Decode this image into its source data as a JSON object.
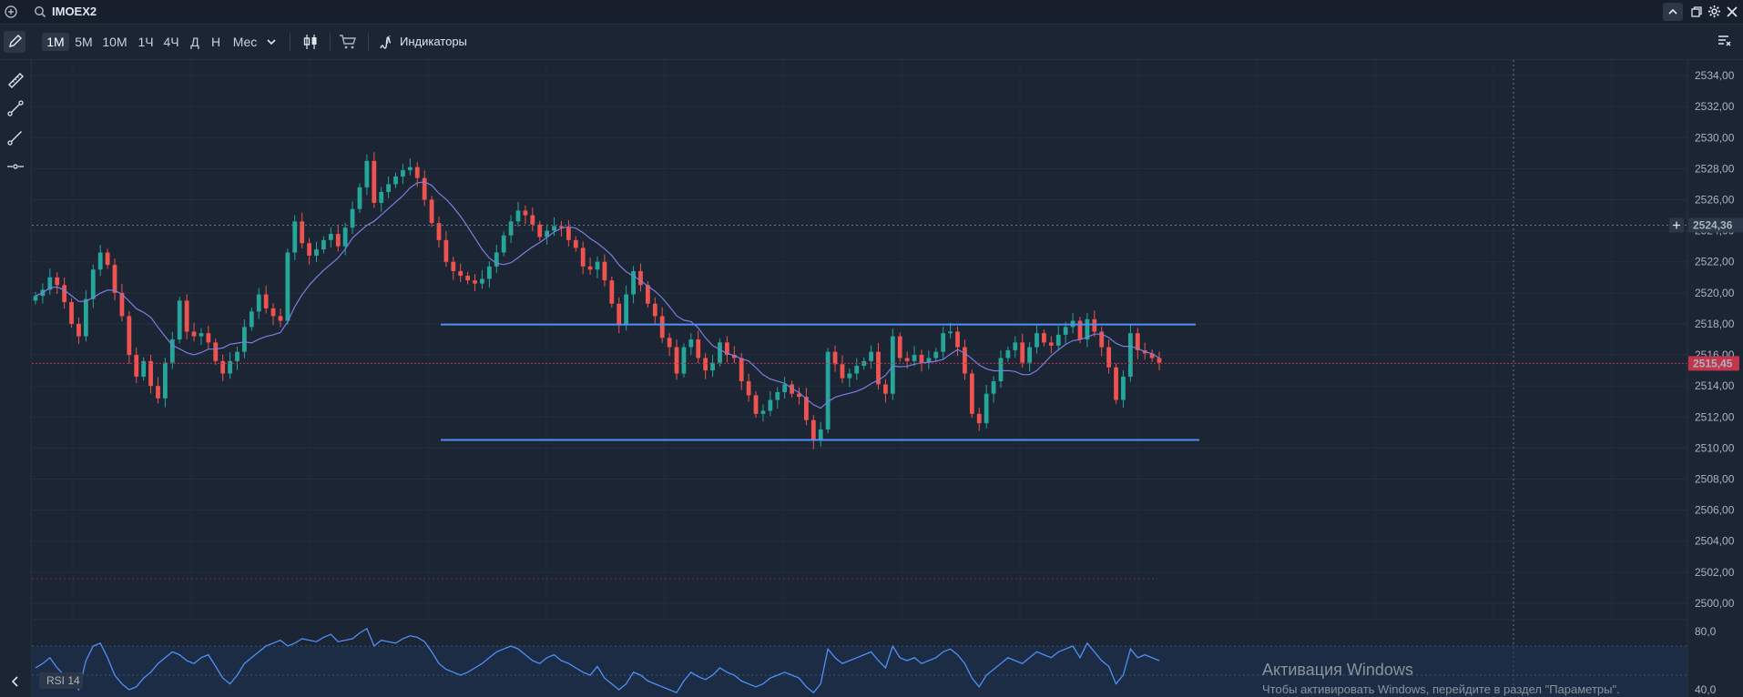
{
  "header": {
    "symbol": "IMOEX2"
  },
  "toolbar": {
    "timeframes": [
      "1М",
      "5М",
      "10М",
      "1Ч",
      "4Ч",
      "Д",
      "Н",
      "Мес"
    ],
    "active_timeframe": "1М",
    "indicators_label": "Индикаторы"
  },
  "price_axis": {
    "ticks": [
      "2534,00",
      "2532,00",
      "2530,00",
      "2528,00",
      "2526,00",
      "2524,00",
      "2522,00",
      "2520,00",
      "2518,00",
      "2516,00",
      "2514,00",
      "2512,00",
      "2510,00",
      "2508,00",
      "2506,00",
      "2504,00",
      "2502,00",
      "2500,00"
    ],
    "crosshair_label": "2524,36",
    "last_price_label": "2515,45"
  },
  "rsi": {
    "name": "RSI 14",
    "ticks": [
      "80,0",
      "40,0"
    ]
  },
  "colors": {
    "background": "#1b2533",
    "up_candle": "#26a69a",
    "down_candle": "#ef5350",
    "ma_line": "#7b7fe0",
    "channel_lines": "#4f8ff7",
    "last_price": "#c2364b",
    "rsi_line": "#4f8ff7"
  },
  "chart_data": {
    "type": "candlestick",
    "symbol": "IMOEX2",
    "interval": "1М",
    "ylim": [
      2499,
      2535
    ],
    "close_series": [
      2519.8,
      2520.2,
      2521,
      2520.5,
      2519.4,
      2518,
      2517.2,
      2519.6,
      2521.5,
      2522.6,
      2521.8,
      2520,
      2518.5,
      2516,
      2514.6,
      2515.6,
      2514,
      2513.2,
      2515.5,
      2517,
      2519.5,
      2517.5,
      2517.2,
      2517.4,
      2516.8,
      2515.6,
      2514.8,
      2515.6,
      2516.2,
      2517.8,
      2518.8,
      2519.9,
      2519,
      2518.5,
      2518.2,
      2522.6,
      2524.6,
      2523.2,
      2522.4,
      2522.8,
      2523.4,
      2523.8,
      2523,
      2524.2,
      2525.4,
      2526.8,
      2528.5,
      2525.8,
      2526.5,
      2527,
      2527.5,
      2527.9,
      2528.1,
      2527.4,
      2526,
      2524.5,
      2523.4,
      2522,
      2521.4,
      2521.1,
      2520.8,
      2520.6,
      2520.9,
      2521.7,
      2522.6,
      2523.7,
      2524.6,
      2525.3,
      2525,
      2524.4,
      2523.6,
      2524,
      2524.3,
      2524.2,
      2523.4,
      2522.9,
      2521.7,
      2521.5,
      2522,
      2520.8,
      2519.3,
      2517.9,
      2519.9,
      2521.4,
      2520.5,
      2519.3,
      2518.5,
      2517.1,
      2516.5,
      2514.8,
      2516.5,
      2517,
      2515.8,
      2515,
      2515.5,
      2516.8,
      2516,
      2515.8,
      2514.3,
      2513.4,
      2512.2,
      2512.4,
      2513.1,
      2513.6,
      2514.1,
      2513.5,
      2513.3,
      2511.8,
      2510.5,
      2511.2,
      2516.2,
      2515.4,
      2514.5,
      2514.8,
      2515.3,
      2515.6,
      2516.2,
      2514.1,
      2513.5,
      2517.2,
      2515.8,
      2515.6,
      2516,
      2515.5,
      2515.8,
      2516.2,
      2517.4,
      2517.5,
      2516.5,
      2514.8,
      2512.2,
      2511.6,
      2513.5,
      2514.3,
      2515.8,
      2516.3,
      2516.8,
      2515.5,
      2516.5,
      2517.4,
      2516.8,
      2516.6,
      2517.3,
      2517.8,
      2518.2,
      2517,
      2518.3,
      2517.5,
      2516.5,
      2515.2,
      2513.1,
      2514.6,
      2517.4,
      2516.3,
      2516.1,
      2515.8,
      2515.5
    ],
    "series": [
      {
        "name": "MA",
        "type": "line"
      }
    ],
    "channel": {
      "upper": 2517.96,
      "lower": 2510.52
    },
    "last_price": 2515.45,
    "crosshair_price": 2524.36,
    "rsi": {
      "name": "RSI 14",
      "ylim": [
        35,
        85
      ],
      "values": [
        55,
        58,
        62,
        55,
        50,
        45,
        40,
        60,
        70,
        72,
        62,
        50,
        44,
        40,
        42,
        48,
        52,
        58,
        62,
        66,
        64,
        60,
        58,
        62,
        64,
        56,
        48,
        44,
        50,
        58,
        62,
        66,
        70,
        72,
        74,
        70,
        72,
        75,
        74,
        73,
        76,
        78,
        73,
        74,
        75,
        79,
        82,
        70,
        74,
        73,
        72,
        75,
        77,
        76,
        73,
        66,
        58,
        54,
        52,
        50,
        52,
        55,
        58,
        62,
        66,
        68,
        70,
        68,
        64,
        60,
        58,
        62,
        64,
        60,
        58,
        55,
        52,
        50,
        56,
        48,
        44,
        40,
        44,
        52,
        50,
        46,
        44,
        42,
        40,
        38,
        46,
        52,
        49,
        47,
        50,
        55,
        52,
        50,
        46,
        44,
        42,
        44,
        48,
        50,
        52,
        50,
        48,
        42,
        38,
        44,
        68,
        62,
        58,
        60,
        62,
        64,
        66,
        60,
        55,
        70,
        62,
        60,
        62,
        58,
        60,
        62,
        66,
        68,
        64,
        58,
        48,
        42,
        50,
        54,
        58,
        62,
        60,
        58,
        62,
        66,
        64,
        62,
        66,
        68,
        70,
        62,
        72,
        66,
        60,
        56,
        44,
        50,
        68,
        62,
        64,
        62,
        60
      ],
      "grid_levels": [
        30,
        50,
        70
      ]
    }
  },
  "watermark": {
    "title": "Активация Windows",
    "subtitle": "Чтобы активировать Windows, перейдите в раздел \"Параметры\"."
  }
}
